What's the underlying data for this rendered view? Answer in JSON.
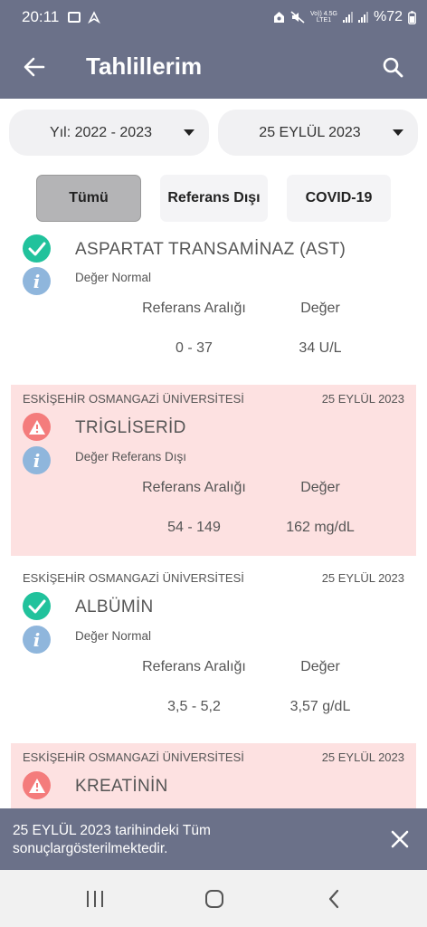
{
  "status_bar": {
    "time": "20:11",
    "network_top": "Vo)) 4.5G",
    "network_bottom": "LTE1",
    "battery": "%72"
  },
  "app_bar": {
    "title": "Tahlillerim",
    "icons": [
      "back-arrow-icon",
      "search-icon"
    ]
  },
  "filters": {
    "year_select": "Yıl: 2022 - 2023",
    "date_select": "25 EYLÜL 2023"
  },
  "tabs": [
    {
      "label": "Tümü",
      "active": true
    },
    {
      "label": "Referans Dışı",
      "active": false
    },
    {
      "label": "COVID-19",
      "active": false
    }
  ],
  "results": [
    {
      "institution": "",
      "date": "",
      "name": "ASPARTAT TRANSAMİNAZ (AST)",
      "status": "Değer Normal",
      "status_icon": "check-icon",
      "ref_header": "Referans Aralığı",
      "value_header": "Değer",
      "range": "0 - 37",
      "value": "34 U/L",
      "out_of_range": false
    },
    {
      "institution": "ESKİŞEHİR OSMANGAZİ ÜNİVERSİTESİ",
      "date": "25 EYLÜL 2023",
      "name": "TRİGLİSERİD",
      "status": "Değer Referans Dışı",
      "status_icon": "warning-icon",
      "ref_header": "Referans Aralığı",
      "value_header": "Değer",
      "range": "54 - 149",
      "value": "162 mg/dL",
      "out_of_range": true
    },
    {
      "institution": "ESKİŞEHİR OSMANGAZİ ÜNİVERSİTESİ",
      "date": "25 EYLÜL 2023",
      "name": "ALBÜMİN",
      "status": "Değer Normal",
      "status_icon": "check-icon",
      "ref_header": "Referans Aralığı",
      "value_header": "Değer",
      "range": "3,5 - 5,2",
      "value": "3,57 g/dL",
      "out_of_range": false
    },
    {
      "institution": "ESKİŞEHİR OSMANGAZİ ÜNİVERSİTESİ",
      "date": "25 EYLÜL 2023",
      "name": "KREATİNİN",
      "status_icon": "warning-icon",
      "out_of_range": true
    }
  ],
  "snackbar": {
    "line1": "25 EYLÜL 2023 tarihindeki Tüm",
    "line2": "sonuçlargösterilmektedir."
  },
  "colors": {
    "app_bar": "#6b7189",
    "normal_icon": "#21c29c",
    "warning_icon": "#f47c7c",
    "out_of_range_bg": "#fde1e1",
    "info_icon": "#8fb6dc"
  }
}
